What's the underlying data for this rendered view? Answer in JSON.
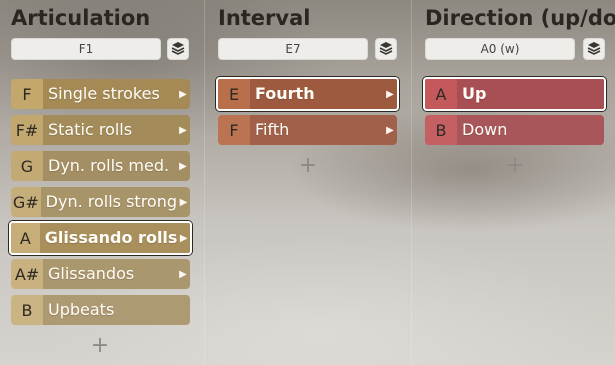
{
  "colors": {
    "articulation_key": "#b99d62",
    "articulation_label": "#a88c55",
    "interval_key": "#b86c47",
    "interval_label": "#a45a3a",
    "direction_key": "#c45d5f",
    "direction_label": "#b05055"
  },
  "columns": [
    {
      "title": "Articulation",
      "key_value": "F1",
      "items": [
        {
          "key": "F",
          "label": "Single strokes",
          "selected": false
        },
        {
          "key": "F#",
          "label": "Static rolls",
          "selected": false
        },
        {
          "key": "G",
          "label": "Dyn. rolls med.",
          "selected": false
        },
        {
          "key": "G#",
          "label": "Dyn. rolls strong",
          "selected": false
        },
        {
          "key": "A",
          "label": "Glissando rolls",
          "selected": true
        },
        {
          "key": "A#",
          "label": "Glissandos",
          "selected": false
        },
        {
          "key": "B",
          "label": "Upbeats",
          "selected": false
        }
      ],
      "add_label": "+"
    },
    {
      "title": "Interval",
      "key_value": "E7",
      "items": [
        {
          "key": "E",
          "label": "Fourth",
          "selected": true
        },
        {
          "key": "F",
          "label": "Fifth",
          "selected": false
        }
      ],
      "add_label": "+"
    },
    {
      "title": "Direction (up/do",
      "key_value": "A0 (w)",
      "items": [
        {
          "key": "A",
          "label": "Up",
          "selected": true
        },
        {
          "key": "B",
          "label": "Down",
          "selected": false
        }
      ],
      "add_label": "+"
    }
  ]
}
